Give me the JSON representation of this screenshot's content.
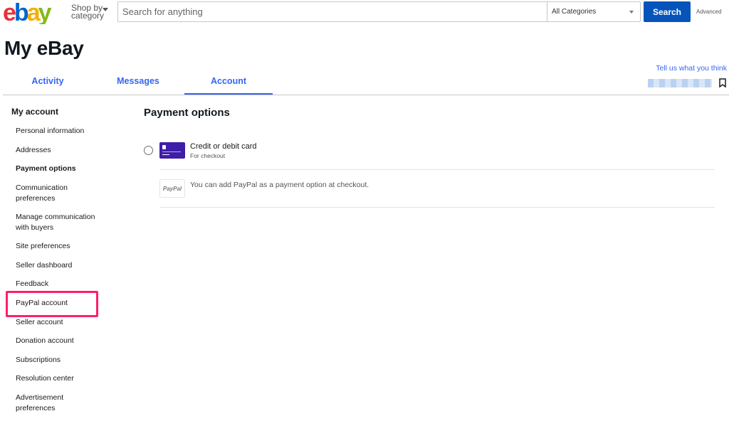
{
  "header": {
    "logo_letters": [
      "e",
      "b",
      "a",
      "y"
    ],
    "logo_colors": [
      "#e53238",
      "#0064d2",
      "#f5af02",
      "#86b817"
    ],
    "shop_by_line1": "Shop by",
    "shop_by_line2": "category",
    "search_placeholder": "Search for anything",
    "category_selected": "All Categories",
    "search_button": "Search",
    "advanced_link": "Advanced"
  },
  "page": {
    "title": "My eBay",
    "feedback_link": "Tell us what you think",
    "tabs": [
      {
        "label": "Activity",
        "active": false
      },
      {
        "label": "Messages",
        "active": false
      },
      {
        "label": "Account",
        "active": true
      }
    ]
  },
  "sidebar": {
    "heading": "My account",
    "items": [
      {
        "label": "Personal information"
      },
      {
        "label": "Addresses"
      },
      {
        "label": "Payment options",
        "active": true
      },
      {
        "label": "Communication preferences"
      },
      {
        "label": "Manage communication with buyers"
      },
      {
        "label": "Site preferences"
      },
      {
        "label": "Seller dashboard"
      },
      {
        "label": "Feedback"
      },
      {
        "label": "PayPal account",
        "highlighted": true
      },
      {
        "label": "Seller account"
      },
      {
        "label": "Donation account"
      },
      {
        "label": "Subscriptions"
      },
      {
        "label": "Resolution center"
      },
      {
        "label": "Advertisement preferences"
      }
    ]
  },
  "main": {
    "title": "Payment options",
    "card_option": {
      "title": "Credit or debit card",
      "subtitle": "For checkout"
    },
    "paypal": {
      "logo_text": "PayPal",
      "message": "You can add PayPal as a payment option at checkout."
    }
  },
  "colors": {
    "link_blue": "#3665f3",
    "search_button": "#0654ba",
    "highlight": "#ff1e6e",
    "card": "#3f1da7"
  }
}
